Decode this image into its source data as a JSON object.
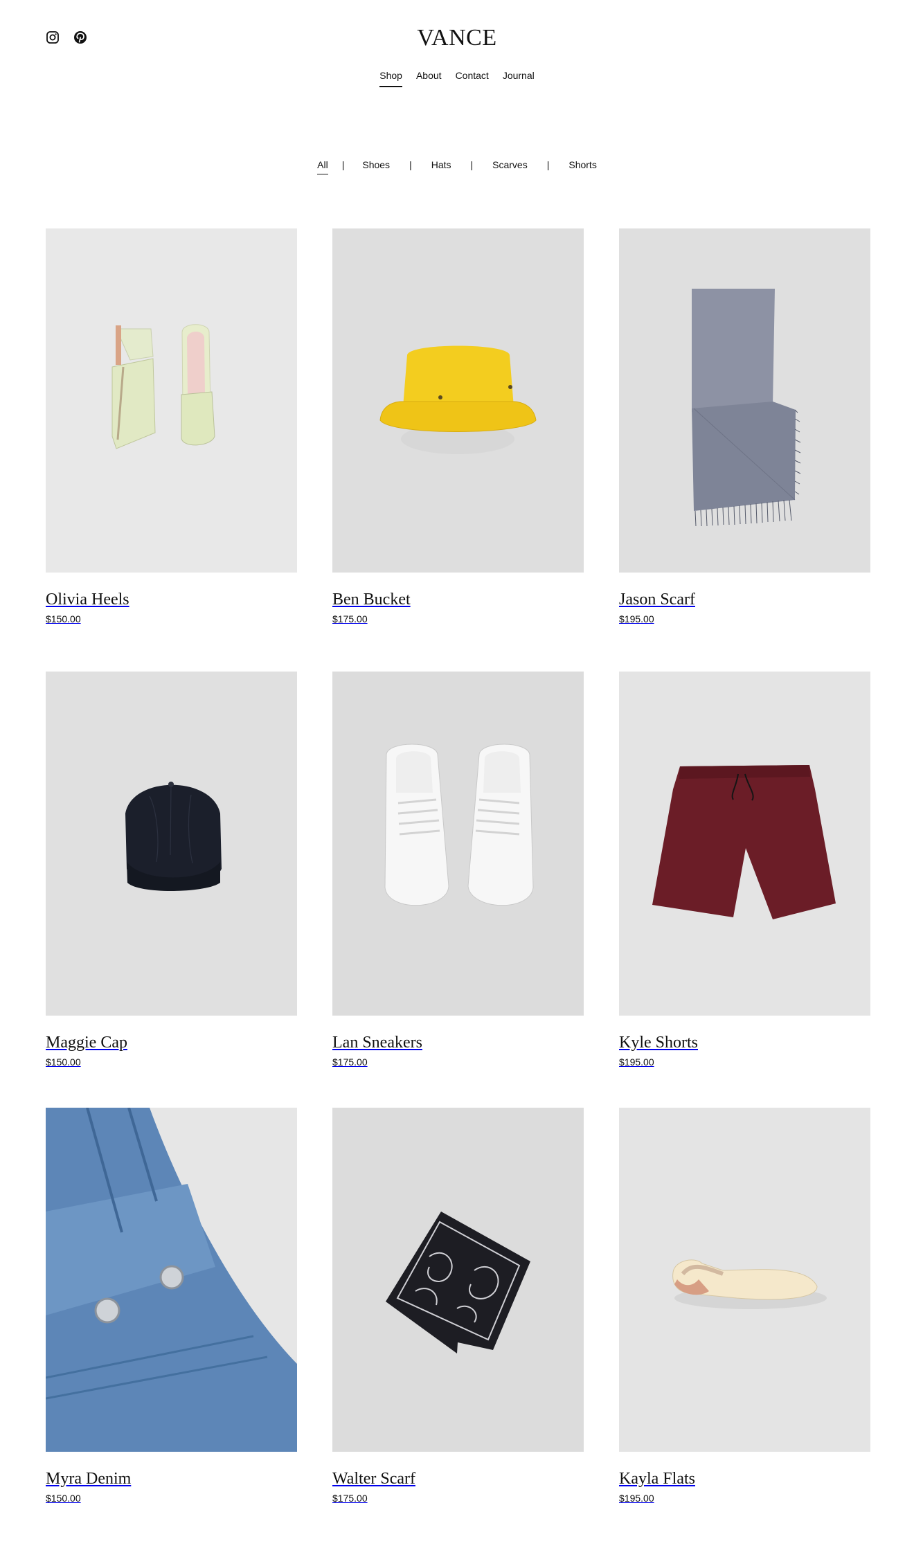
{
  "brand": "VANCE",
  "social": [
    {
      "icon": "instagram-icon"
    },
    {
      "icon": "pinterest-icon"
    }
  ],
  "nav": [
    "Shop",
    "About",
    "Contact",
    "Journal"
  ],
  "nav_active": "Shop",
  "filters": [
    "All",
    "Shoes",
    "Hats",
    "Scarves",
    "Shorts"
  ],
  "filter_active": "All",
  "separator": "|",
  "products": [
    {
      "name": "Olivia Heels",
      "price": "$150.00",
      "bg": "#e8e8e8"
    },
    {
      "name": "Ben Bucket",
      "price": "$175.00",
      "bg": "#dedede"
    },
    {
      "name": "Jason Scarf",
      "price": "$195.00",
      "bg": "#dfdfdf"
    },
    {
      "name": "Maggie Cap",
      "price": "$150.00",
      "bg": "#e0e0e0"
    },
    {
      "name": "Lan Sneakers",
      "price": "$175.00",
      "bg": "#dcdcdc"
    },
    {
      "name": "Kyle Shorts",
      "price": "$195.00",
      "bg": "#e4e4e4"
    },
    {
      "name": "Myra Denim",
      "price": "$150.00",
      "bg": "#e6e6e6"
    },
    {
      "name": "Walter Scarf",
      "price": "$175.00",
      "bg": "#dcdcdc"
    },
    {
      "name": "Kayla Flats",
      "price": "$195.00",
      "bg": "#e4e4e4"
    }
  ]
}
